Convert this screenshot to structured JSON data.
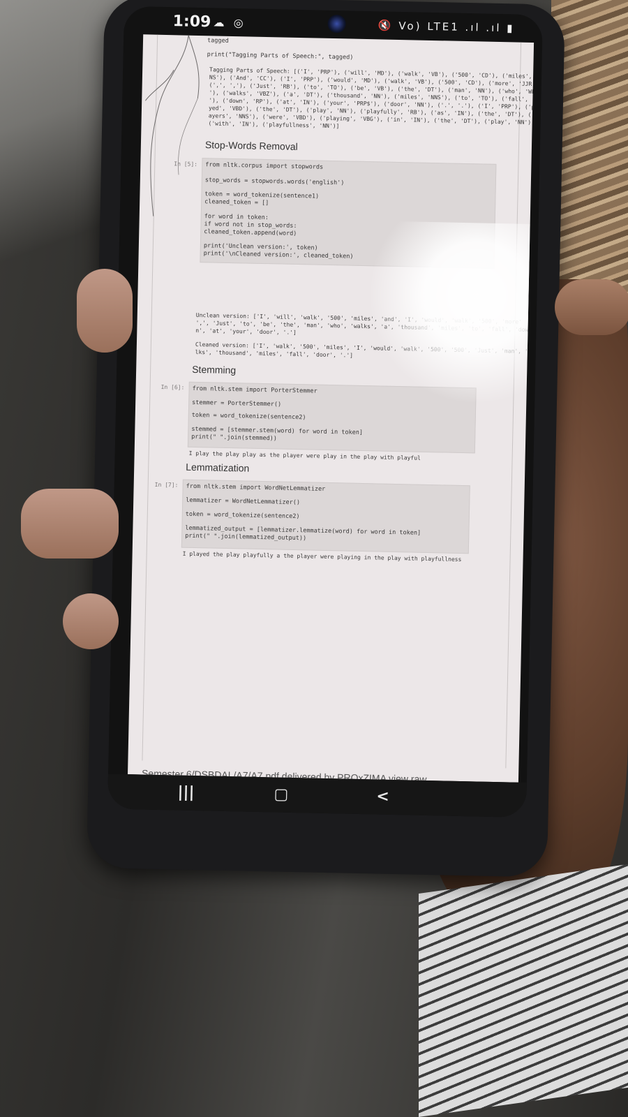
{
  "statusbar": {
    "time": "1:09",
    "left_icons": "☁ ◎",
    "right_icons": "🔇 Vo) LTE1 .ıl .ıl ▮"
  },
  "notebook": {
    "tagging_cell": {
      "code": "tagged",
      "print_line": "print(\"Tagging Parts of Speech:\", tagged)",
      "output_lines": [
        "Tagging Parts of Speech: [('I', 'PRP'), ('will', 'MD'), ('walk', 'VB'), ('500', 'CD'), ('miles', 'N",
        "NS'), ('And', 'CC'), ('I', 'PRP'), ('would', 'MD'), ('walk', 'VB'), ('500', 'CD'), ('more', 'JJR'),",
        "(',', ','), ('Just', 'RB'), ('to', 'TO'), ('be', 'VB'), ('the', 'DT'), ('man', 'NN'), ('who', 'WP",
        "'), ('walks', 'VBZ'), ('a', 'DT'), ('thousand', 'NN'), ('miles', 'NNS'), ('to', 'TO'), ('fall', 'VB",
        "'), ('down', 'RP'), ('at', 'IN'), ('your', 'PRP$'), ('door', 'NN'), ('.', '.'), ('I', 'PRP'), ('pla",
        "yed', 'VBD'), ('the', 'DT'), ('play', 'NN'), ('playfully', 'RB'), ('as', 'IN'), ('the', 'DT'), ('pl",
        "ayers', 'NNS'), ('were', 'VBD'), ('playing', 'VBG'), ('in', 'IN'), ('the', 'DT'), ('play', 'NN'),",
        "('with', 'IN'), ('playfullness', 'NN')]"
      ]
    },
    "stopwords": {
      "heading": "Stop-Words Removal",
      "prompt": "In [5]:",
      "code_lines": [
        "from nltk.corpus import stopwords",
        "",
        "stop_words = stopwords.words('english')",
        "",
        "token = word_tokenize(sentence1)",
        "cleaned_token = []",
        "",
        "for word in token:",
        "    if word not in stop_words:",
        "        cleaned_token.append(word)",
        "",
        "print('Unclean version:', token)",
        "print('\\nCleaned version:', cleaned_token)"
      ],
      "output_lines": [
        "Unclean version: ['I', 'will', 'walk', '500', 'miles', 'and', 'I', 'would', 'walk', '500', 'more'",
        "',', 'Just', 'to', 'be', 'the', 'man', 'who', 'walks', 'a', 'thousand', 'miles', 'to', 'fall', 'dow",
        "n', 'at', 'your', 'door', '.']",
        "",
        "Cleaned version: ['I', 'walk', '500', 'miles', 'I', 'would', 'walk', '500', '500', 'Just', 'man', 'wa",
        "lks', 'thousand', 'miles', 'fall', 'door', '.']"
      ]
    },
    "stemming": {
      "heading": "Stemming",
      "prompt": "In [6]:",
      "code_lines": [
        "from nltk.stem import PorterStemmer",
        "",
        "stemmer = PorterStemmer()",
        "",
        "token = word_tokenize(sentence2)",
        "",
        "stemmed = [stemmer.stem(word) for word in token]",
        "print(\" \".join(stemmed))"
      ],
      "output": "I play the play play as the player were play in the play with playful"
    },
    "lemmatization": {
      "heading": "Lemmatization",
      "prompt": "In [7]:",
      "code_lines": [
        "from nltk.stem import WordNetLemmatizer",
        "",
        "lemmatizer = WordNetLemmatizer()",
        "",
        "token = word_tokenize(sentence2)",
        "",
        "lemmatized_output = [lemmatizer.lemmatize(word) for word in token]",
        "print(\" \".join(lemmatized_output))"
      ],
      "output": "I played the play playfully a the player were playing in the play with playfullness"
    },
    "footer": "Semester 6/DSBDAL/A7/A7.pdf delivered by PROxZIMA view raw"
  },
  "navbar": {
    "recents": "|||",
    "home": "▢",
    "back": "<"
  }
}
